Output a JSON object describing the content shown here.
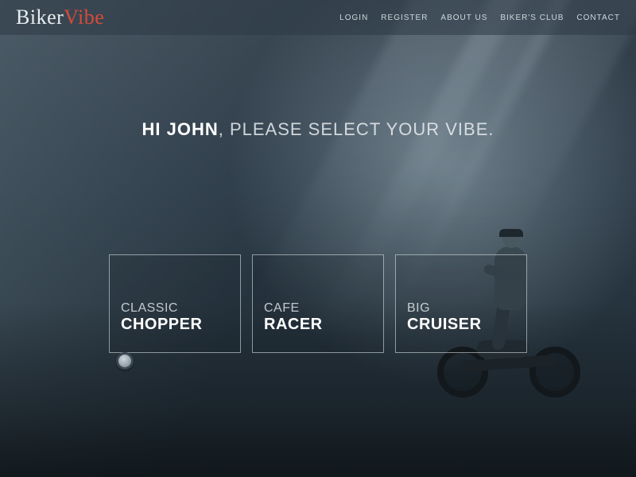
{
  "brand": {
    "part1": "Biker",
    "part2": "Vibe"
  },
  "nav": {
    "login": "LOGIN",
    "register": "REGISTER",
    "about": "ABOUT US",
    "club": "BIKER'S CLUB",
    "contact": "CONTACT"
  },
  "headline": {
    "greeting": "HI JOHN",
    "rest": ", PLEASE SELECT YOUR VIBE."
  },
  "cards": [
    {
      "line1": "CLASSIC",
      "line2": "CHOPPER"
    },
    {
      "line1": "CAFE",
      "line2": "RACER"
    },
    {
      "line1": "BIG",
      "line2": "CRUISER"
    }
  ]
}
